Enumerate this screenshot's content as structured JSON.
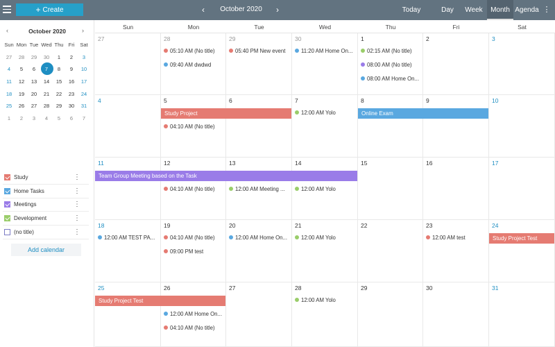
{
  "colors": {
    "topbar": "#627380",
    "accent": "#1e8ec2",
    "study": "#e57b72",
    "home_tasks": "#5aa8e0",
    "meetings": "#9a7ce8",
    "development": "#9acd6a",
    "no_title": "#7b7bc4",
    "create": "#26a0c9"
  },
  "topbar": {
    "create_label": "Create",
    "month_title": "October 2020",
    "prev_icon": "‹",
    "next_icon": "›",
    "today_label": "Today",
    "views": {
      "day": "Day",
      "week": "Week",
      "month": "Month",
      "agenda": "Agenda"
    },
    "active_view": "Month",
    "more_icon": "⋮"
  },
  "mini_calendar": {
    "title": "October 2020",
    "prev_icon": "‹",
    "next_icon": "›",
    "weekday_labels": [
      "Sun",
      "Mon",
      "Tue",
      "Wed",
      "Thu",
      "Fri",
      "Sat"
    ],
    "selected_day": "7",
    "weeks": [
      [
        {
          "d": "27",
          "m": "prev"
        },
        {
          "d": "28",
          "m": "prev"
        },
        {
          "d": "29",
          "m": "prev"
        },
        {
          "d": "30",
          "m": "prev"
        },
        {
          "d": "1",
          "m": "cur"
        },
        {
          "d": "2",
          "m": "cur"
        },
        {
          "d": "3",
          "m": "cur"
        }
      ],
      [
        {
          "d": "4",
          "m": "cur"
        },
        {
          "d": "5",
          "m": "cur"
        },
        {
          "d": "6",
          "m": "cur"
        },
        {
          "d": "7",
          "m": "cur"
        },
        {
          "d": "8",
          "m": "cur"
        },
        {
          "d": "9",
          "m": "cur"
        },
        {
          "d": "10",
          "m": "cur"
        }
      ],
      [
        {
          "d": "11",
          "m": "cur"
        },
        {
          "d": "12",
          "m": "cur"
        },
        {
          "d": "13",
          "m": "cur"
        },
        {
          "d": "14",
          "m": "cur"
        },
        {
          "d": "15",
          "m": "cur"
        },
        {
          "d": "16",
          "m": "cur"
        },
        {
          "d": "17",
          "m": "cur"
        }
      ],
      [
        {
          "d": "18",
          "m": "cur"
        },
        {
          "d": "19",
          "m": "cur"
        },
        {
          "d": "20",
          "m": "cur"
        },
        {
          "d": "21",
          "m": "cur"
        },
        {
          "d": "22",
          "m": "cur"
        },
        {
          "d": "23",
          "m": "cur"
        },
        {
          "d": "24",
          "m": "cur"
        }
      ],
      [
        {
          "d": "25",
          "m": "cur"
        },
        {
          "d": "26",
          "m": "cur"
        },
        {
          "d": "27",
          "m": "cur"
        },
        {
          "d": "28",
          "m": "cur"
        },
        {
          "d": "29",
          "m": "cur"
        },
        {
          "d": "30",
          "m": "cur"
        },
        {
          "d": "31",
          "m": "cur"
        }
      ],
      [
        {
          "d": "1",
          "m": "next"
        },
        {
          "d": "2",
          "m": "next"
        },
        {
          "d": "3",
          "m": "next"
        },
        {
          "d": "4",
          "m": "next"
        },
        {
          "d": "5",
          "m": "next"
        },
        {
          "d": "6",
          "m": "next"
        },
        {
          "d": "7",
          "m": "next"
        }
      ]
    ]
  },
  "calendars": [
    {
      "label": "Study",
      "color": "#e57b72",
      "checked": true
    },
    {
      "label": "Home Tasks",
      "color": "#5aa8e0",
      "checked": true
    },
    {
      "label": "Meetings",
      "color": "#9a7ce8",
      "checked": true
    },
    {
      "label": "Development",
      "color": "#9acd6a",
      "checked": true
    },
    {
      "label": "(no title)",
      "color": "#7b7bc4",
      "checked": false
    }
  ],
  "add_calendar_label": "Add calendar",
  "weekdays": [
    "Sun",
    "Mon",
    "Tue",
    "Wed",
    "Thu",
    "Fri",
    "Sat"
  ],
  "weeks": [
    {
      "days": [
        {
          "d": "27",
          "m": "prev"
        },
        {
          "d": "28",
          "m": "prev"
        },
        {
          "d": "29",
          "m": "prev"
        },
        {
          "d": "30",
          "m": "prev"
        },
        {
          "d": "1",
          "m": "cur"
        },
        {
          "d": "2",
          "m": "cur"
        },
        {
          "d": "3",
          "m": "cur"
        }
      ],
      "bars": [],
      "events": [
        {
          "col": 1,
          "row": 0,
          "time": "05:10 AM",
          "title": "(No title)",
          "color": "#e57b72"
        },
        {
          "col": 1,
          "row": 1,
          "time": "09:40 AM",
          "title": "dwdwd",
          "color": "#5aa8e0"
        },
        {
          "col": 2,
          "row": 0,
          "time": "05:40 PM",
          "title": "New event",
          "color": "#e57b72"
        },
        {
          "col": 3,
          "row": 0,
          "time": "11:20 AM",
          "title": "Home On...",
          "color": "#5aa8e0"
        },
        {
          "col": 4,
          "row": 0,
          "time": "02:15 AM",
          "title": "(No title)",
          "color": "#9acd6a"
        },
        {
          "col": 4,
          "row": 1,
          "time": "08:00 AM",
          "title": "(No title)",
          "color": "#9a7ce8"
        },
        {
          "col": 4,
          "row": 2,
          "time": "08:00 AM",
          "title": "Home On...",
          "color": "#5aa8e0"
        }
      ]
    },
    {
      "days": [
        {
          "d": "4",
          "m": "cur"
        },
        {
          "d": "5",
          "m": "cur"
        },
        {
          "d": "6",
          "m": "cur"
        },
        {
          "d": "7",
          "m": "cur"
        },
        {
          "d": "8",
          "m": "cur"
        },
        {
          "d": "9",
          "m": "cur"
        },
        {
          "d": "10",
          "m": "cur"
        }
      ],
      "bars": [
        {
          "start": 1,
          "span": 2,
          "title": "Study Project",
          "color": "#e57b72"
        },
        {
          "start": 4,
          "span": 2,
          "title": "Online Exam",
          "color": "#5aa8e0"
        }
      ],
      "events": [
        {
          "col": 1,
          "row": 1,
          "time": "04:10 AM",
          "title": "(No title)",
          "color": "#e57b72"
        },
        {
          "col": 3,
          "row": 0,
          "time": "12:00 AM",
          "title": "Yolo",
          "color": "#9acd6a"
        }
      ]
    },
    {
      "days": [
        {
          "d": "11",
          "m": "cur"
        },
        {
          "d": "12",
          "m": "cur"
        },
        {
          "d": "13",
          "m": "cur"
        },
        {
          "d": "14",
          "m": "cur"
        },
        {
          "d": "15",
          "m": "cur"
        },
        {
          "d": "16",
          "m": "cur"
        },
        {
          "d": "17",
          "m": "cur"
        }
      ],
      "bars": [
        {
          "start": 0,
          "span": 4,
          "title": "Team Group Meeting based on the Task",
          "color": "#9a7ce8"
        }
      ],
      "events": [
        {
          "col": 1,
          "row": 1,
          "time": "04:10 AM",
          "title": "(No title)",
          "color": "#e57b72"
        },
        {
          "col": 2,
          "row": 1,
          "time": "12:00 AM",
          "title": "Meeting ...",
          "color": "#9acd6a"
        },
        {
          "col": 3,
          "row": 1,
          "time": "12:00 AM",
          "title": "Yolo",
          "color": "#9acd6a"
        }
      ]
    },
    {
      "days": [
        {
          "d": "18",
          "m": "cur"
        },
        {
          "d": "19",
          "m": "cur"
        },
        {
          "d": "20",
          "m": "cur"
        },
        {
          "d": "21",
          "m": "cur"
        },
        {
          "d": "22",
          "m": "cur"
        },
        {
          "d": "23",
          "m": "cur"
        },
        {
          "d": "24",
          "m": "cur"
        }
      ],
      "bars": [
        {
          "start": 6,
          "span": 1,
          "title": "Study Project Test",
          "color": "#e57b72"
        }
      ],
      "events": [
        {
          "col": 0,
          "row": 0,
          "time": "12:00 AM",
          "title": "TEST PA...",
          "color": "#5aa8e0"
        },
        {
          "col": 1,
          "row": 0,
          "time": "04:10 AM",
          "title": "(No title)",
          "color": "#e57b72"
        },
        {
          "col": 1,
          "row": 1,
          "time": "09:00 PM",
          "title": "test",
          "color": "#e57b72"
        },
        {
          "col": 2,
          "row": 0,
          "time": "12:00 AM",
          "title": "Home On...",
          "color": "#5aa8e0"
        },
        {
          "col": 3,
          "row": 0,
          "time": "12:00 AM",
          "title": "Yolo",
          "color": "#9acd6a"
        },
        {
          "col": 5,
          "row": 0,
          "time": "12:00 AM",
          "title": "test",
          "color": "#e57b72"
        }
      ]
    },
    {
      "days": [
        {
          "d": "25",
          "m": "cur"
        },
        {
          "d": "26",
          "m": "cur"
        },
        {
          "d": "27",
          "m": "cur"
        },
        {
          "d": "28",
          "m": "cur"
        },
        {
          "d": "29",
          "m": "cur"
        },
        {
          "d": "30",
          "m": "cur"
        },
        {
          "d": "31",
          "m": "cur"
        }
      ],
      "bars": [
        {
          "start": 0,
          "span": 2,
          "title": "Study Project Test",
          "color": "#e57b72"
        }
      ],
      "events": [
        {
          "col": 1,
          "row": 1,
          "time": "12:00 AM",
          "title": "Home On...",
          "color": "#5aa8e0"
        },
        {
          "col": 1,
          "row": 2,
          "time": "04:10 AM",
          "title": "(No title)",
          "color": "#e57b72"
        },
        {
          "col": 3,
          "row": 0,
          "time": "12:00 AM",
          "title": "Yolo",
          "color": "#9acd6a"
        }
      ]
    }
  ]
}
